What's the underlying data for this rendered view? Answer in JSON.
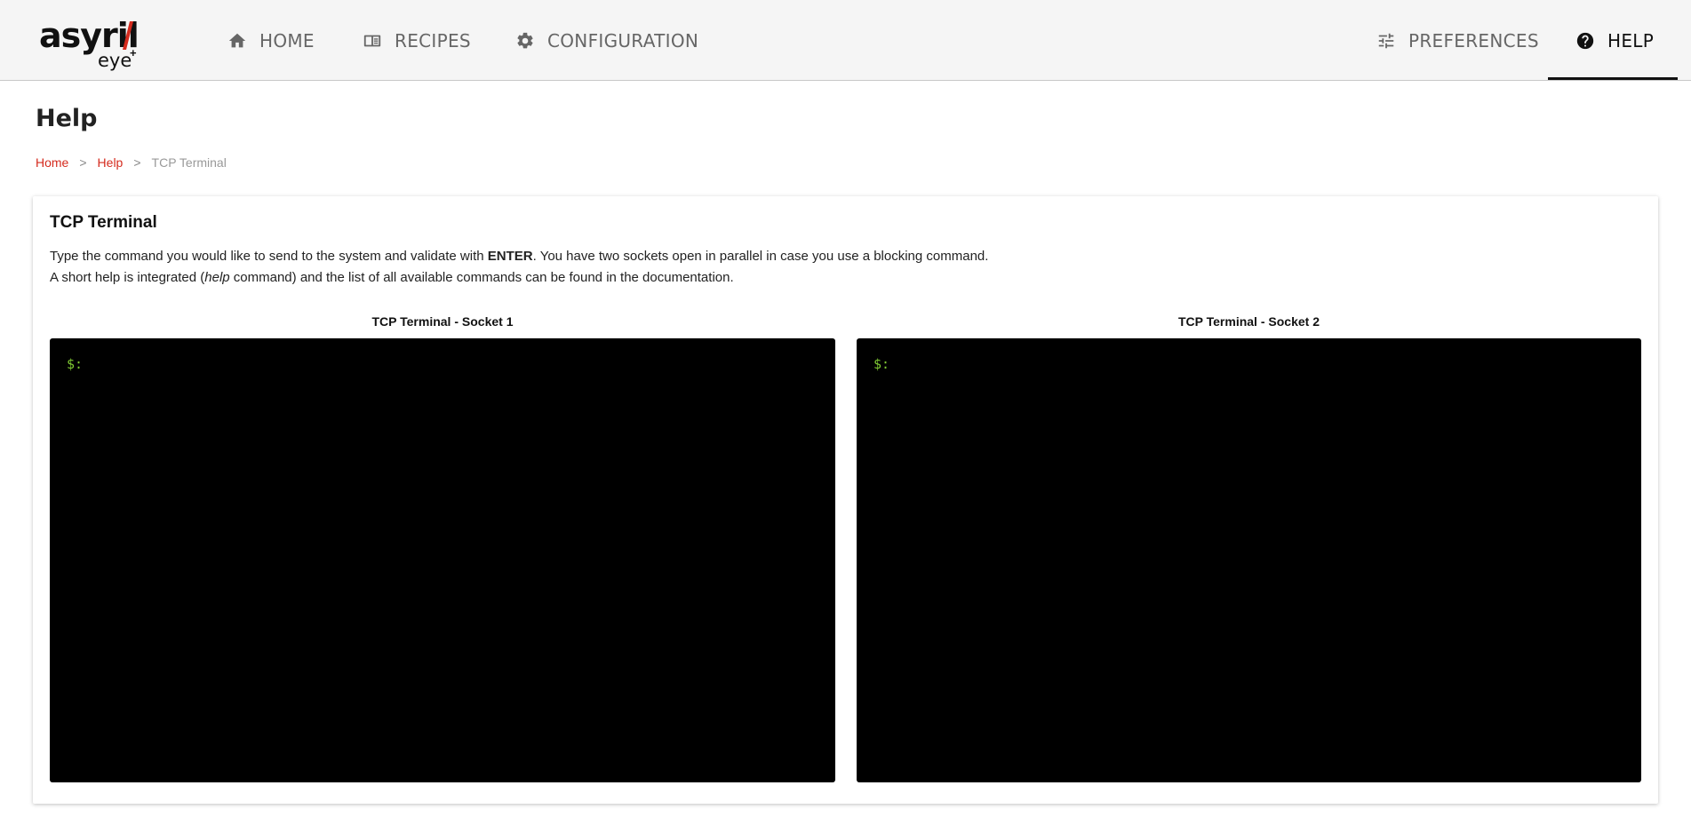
{
  "brand": {
    "name": "asyril",
    "subname": "eye",
    "superscript": "+"
  },
  "nav": {
    "home": {
      "label": "HOME",
      "icon": "home-icon"
    },
    "recipes": {
      "label": "RECIPES",
      "icon": "book-icon"
    },
    "configuration": {
      "label": "CONFIGURATION",
      "icon": "gear-icon"
    },
    "preferences": {
      "label": "PREFERENCES",
      "icon": "sliders-icon"
    },
    "help": {
      "label": "HELP",
      "icon": "help-circle-icon",
      "active": true
    }
  },
  "page": {
    "title": "Help"
  },
  "breadcrumb": {
    "home": "Home",
    "help": "Help",
    "current": "TCP Terminal",
    "separator": ">"
  },
  "card": {
    "title": "TCP Terminal",
    "line1_pre": "Type the command you would like to send to the system and validate with ",
    "line1_key": "ENTER",
    "line1_post": ". You have two sockets open in parallel in case you use a blocking command.",
    "line2_pre": "A short help is integrated (",
    "line2_cmd": "help",
    "line2_post": " command) and the list of all available commands can be found in the documentation."
  },
  "terminals": [
    {
      "label": "TCP Terminal - Socket 1",
      "prompt": "$:"
    },
    {
      "label": "TCP Terminal - Socket 2",
      "prompt": "$:"
    }
  ],
  "colors": {
    "accent": "#d52b1e",
    "navbar_bg": "#f5f5f5",
    "terminal_bg": "#000000",
    "prompt": "#7ec832"
  }
}
